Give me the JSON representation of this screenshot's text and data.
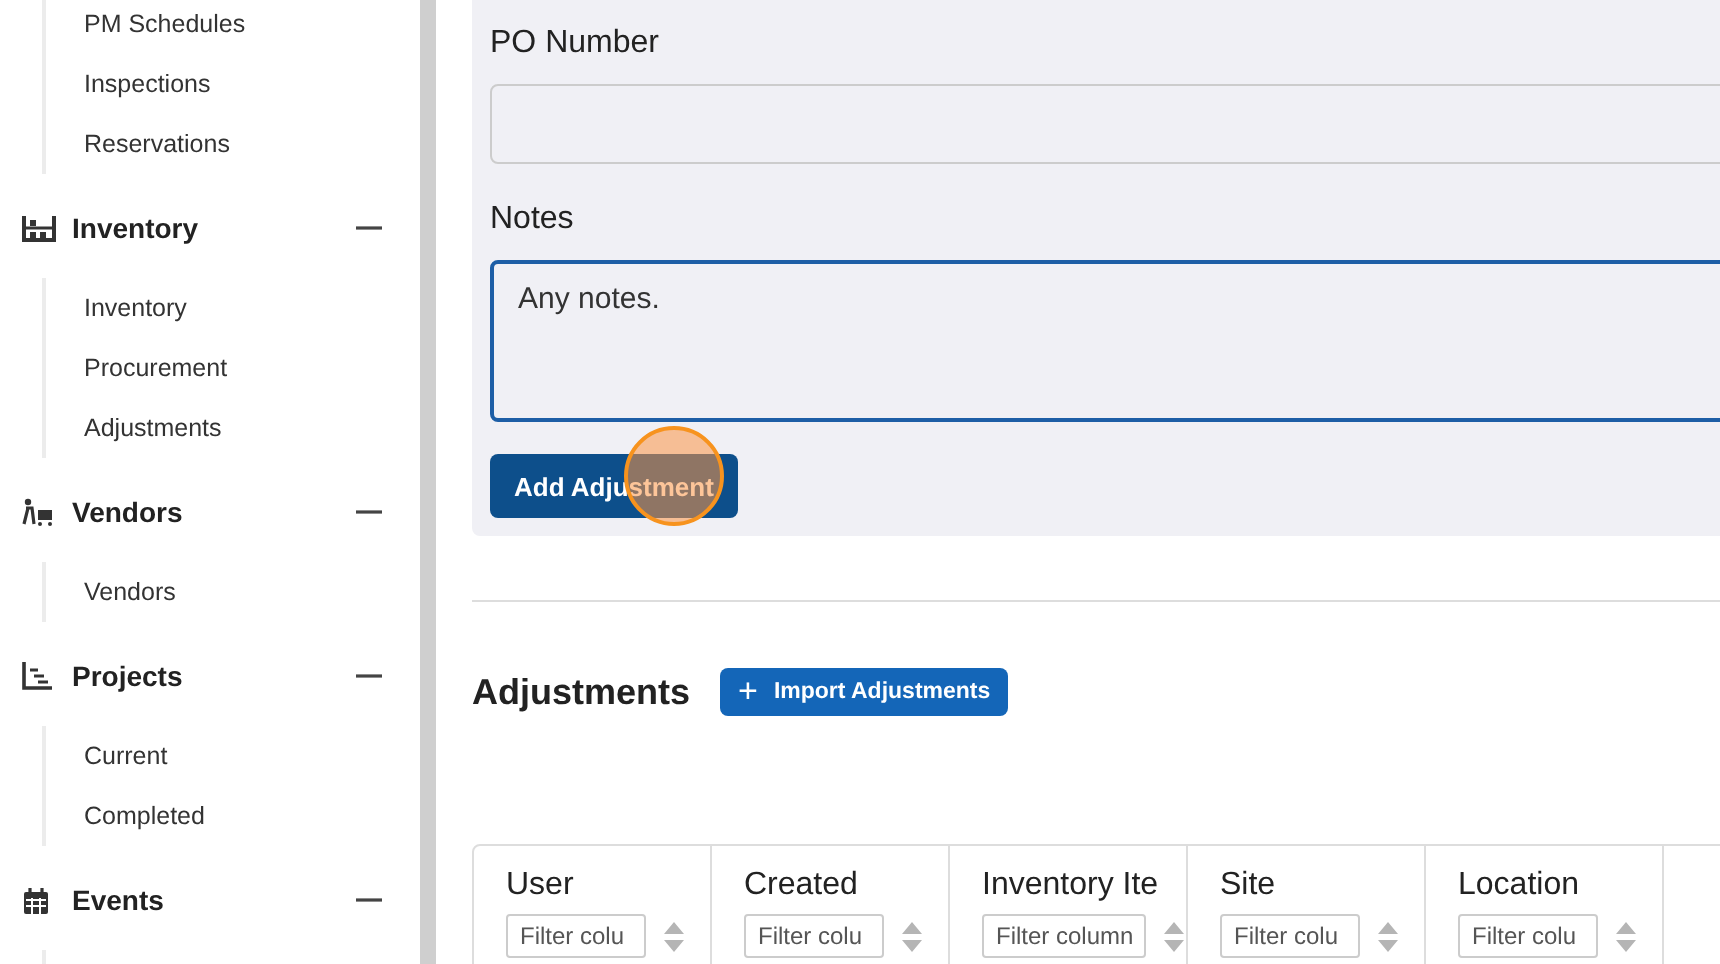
{
  "sidebar": {
    "groups": [
      {
        "items": [
          "PM Schedules",
          "Inspections",
          "Reservations"
        ]
      },
      {
        "title": "Inventory",
        "expanded": true,
        "items": [
          "Inventory",
          "Procurement",
          "Adjustments"
        ]
      },
      {
        "title": "Vendors",
        "expanded": true,
        "items": [
          "Vendors"
        ]
      },
      {
        "title": "Projects",
        "expanded": true,
        "items": [
          "Current",
          "Completed"
        ]
      },
      {
        "title": "Events",
        "expanded": true
      }
    ]
  },
  "form": {
    "fields": [
      {
        "kind": "input",
        "label": "PO Number"
      },
      {
        "kind": "textarea",
        "label": "Notes",
        "value": "Any notes.",
        "focused": true
      }
    ],
    "submit": "Add Adjustment"
  },
  "section": {
    "title": "Adjustments",
    "import_button": {
      "icon": "+",
      "label": "Import Adjustments"
    }
  },
  "table": {
    "columns": [
      {
        "title": "User",
        "placeholder": "Filter colu"
      },
      {
        "title": "Created",
        "placeholder": "Filter colu"
      },
      {
        "title": "Inventory Ite",
        "placeholder": "Filter column"
      },
      {
        "title": "Site",
        "placeholder": "Filter colu"
      },
      {
        "title": "Location",
        "placeholder": "Filter colu"
      }
    ]
  }
}
